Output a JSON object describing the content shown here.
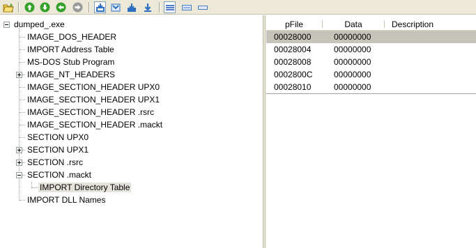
{
  "toolbar": {
    "buttons": [
      "open-file",
      "go-up",
      "go-down",
      "go-back",
      "go-forward",
      "save",
      "save-as",
      "export",
      "export-all",
      "view-detail",
      "view-list",
      "view-icons"
    ]
  },
  "tree": {
    "root": "dumped_.exe",
    "items": [
      {
        "label": "IMAGE_DOS_HEADER"
      },
      {
        "label": "IMPORT Address Table"
      },
      {
        "label": "MS-DOS Stub Program"
      },
      {
        "label": "IMAGE_NT_HEADERS"
      },
      {
        "label": "IMAGE_SECTION_HEADER UPX0"
      },
      {
        "label": "IMAGE_SECTION_HEADER UPX1"
      },
      {
        "label": "IMAGE_SECTION_HEADER .rsrc"
      },
      {
        "label": "IMAGE_SECTION_HEADER .mackt"
      },
      {
        "label": "SECTION UPX0"
      },
      {
        "label": "SECTION UPX1"
      },
      {
        "label": "SECTION .rsrc"
      },
      {
        "label": "SECTION .mackt"
      },
      {
        "label": "IMPORT Directory Table"
      },
      {
        "label": "IMPORT DLL Names"
      }
    ]
  },
  "list": {
    "columns": [
      "pFile",
      "Data",
      "Description"
    ],
    "rows": [
      {
        "pfile": "00028000",
        "data": "00000000",
        "desc": ""
      },
      {
        "pfile": "00028004",
        "data": "00000000",
        "desc": ""
      },
      {
        "pfile": "00028008",
        "data": "00000000",
        "desc": ""
      },
      {
        "pfile": "0002800C",
        "data": "00000000",
        "desc": ""
      },
      {
        "pfile": "00028010",
        "data": "00000000",
        "desc": ""
      }
    ]
  }
}
